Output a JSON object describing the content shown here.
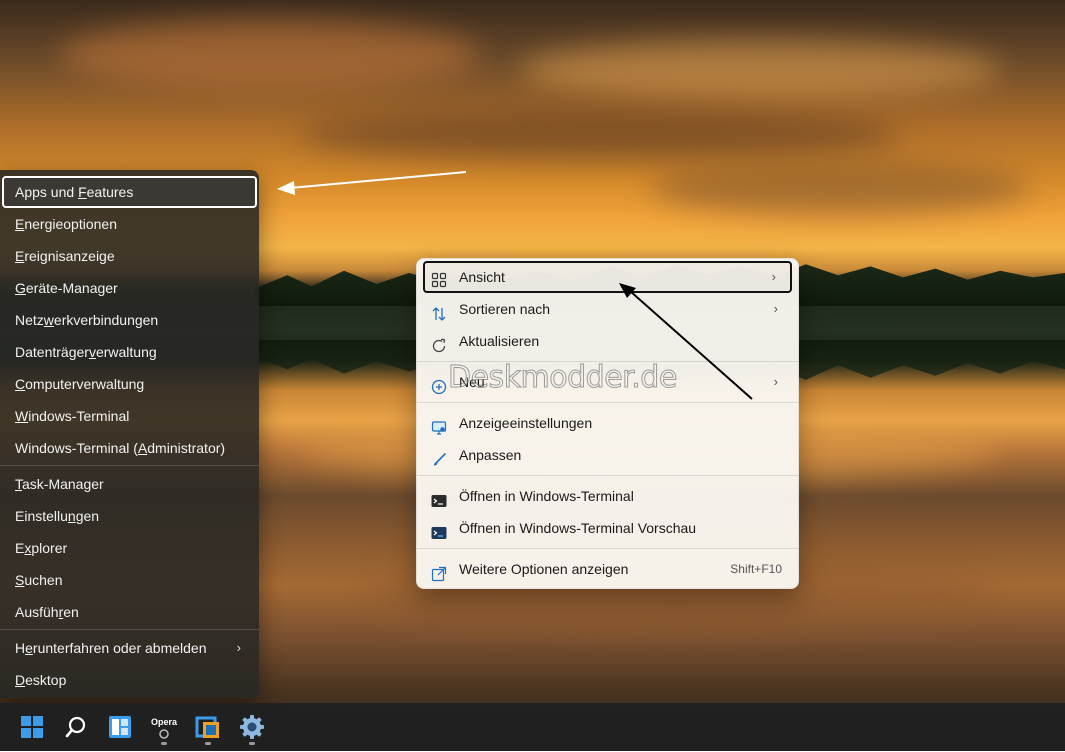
{
  "winx_menu": {
    "items": [
      {
        "label_pre": "Apps und ",
        "label_u": "F",
        "label_post": "eatures",
        "active": true
      },
      {
        "label_pre": "",
        "label_u": "E",
        "label_post": "nergieoptionen"
      },
      {
        "label_pre": "",
        "label_u": "E",
        "label_post": "reignisanzeige"
      },
      {
        "label_pre": "",
        "label_u": "G",
        "label_post": "eräte-Manager"
      },
      {
        "label_pre": "Netz",
        "label_u": "w",
        "label_post": "erkverbindungen"
      },
      {
        "label_pre": "Datenträger",
        "label_u": "v",
        "label_post": "erwaltung"
      },
      {
        "label_pre": "",
        "label_u": "C",
        "label_post": "omputerverwaltung"
      },
      {
        "label_pre": "",
        "label_u": "W",
        "label_post": "indows-Terminal"
      },
      {
        "label_pre": "Windows-Terminal (",
        "label_u": "A",
        "label_post": "dministrator)"
      },
      {
        "label_pre": "",
        "label_u": "T",
        "label_post": "ask-Manager"
      },
      {
        "label_pre": "Einstellu",
        "label_u": "n",
        "label_post": "gen"
      },
      {
        "label_pre": "E",
        "label_u": "x",
        "label_post": "plorer"
      },
      {
        "label_pre": "",
        "label_u": "S",
        "label_post": "uchen"
      },
      {
        "label_pre": "Ausfüh",
        "label_u": "r",
        "label_post": "en"
      },
      {
        "label_pre": "H",
        "label_u": "e",
        "label_post": "runterfahren oder abmelden",
        "chevron": "›"
      },
      {
        "label_pre": "",
        "label_u": "D",
        "label_post": "esktop"
      }
    ]
  },
  "context_menu": {
    "items": [
      {
        "label": "Ansicht",
        "icon": "grid-icon",
        "chevron": "›",
        "active": true
      },
      {
        "label": "Sortieren nach",
        "icon": "sort-icon",
        "chevron": "›"
      },
      {
        "label": "Aktualisieren",
        "icon": "refresh-icon"
      },
      {
        "label": "Neu",
        "icon": "plus-circle-icon",
        "chevron": "›"
      },
      {
        "label": "Anzeigeeinstellungen",
        "icon": "display-icon"
      },
      {
        "label": "Anpassen",
        "icon": "brush-icon"
      },
      {
        "label": "Öffnen in Windows-Terminal",
        "icon": "terminal-icon"
      },
      {
        "label": "Öffnen in Windows-Terminal Vorschau",
        "icon": "terminal-preview-icon"
      },
      {
        "label": "Weitere Optionen anzeigen",
        "icon": "external-icon",
        "shortcut": "Shift+F10"
      }
    ]
  },
  "watermark": "Deskmodder.de",
  "taskbar": {
    "opera_label": "Opera"
  },
  "colors": {
    "winx_bg": "#2a2a24",
    "context_bg": "#f9f6f0",
    "taskbar_bg": "#202020",
    "win_blue": "#3b9dea"
  }
}
